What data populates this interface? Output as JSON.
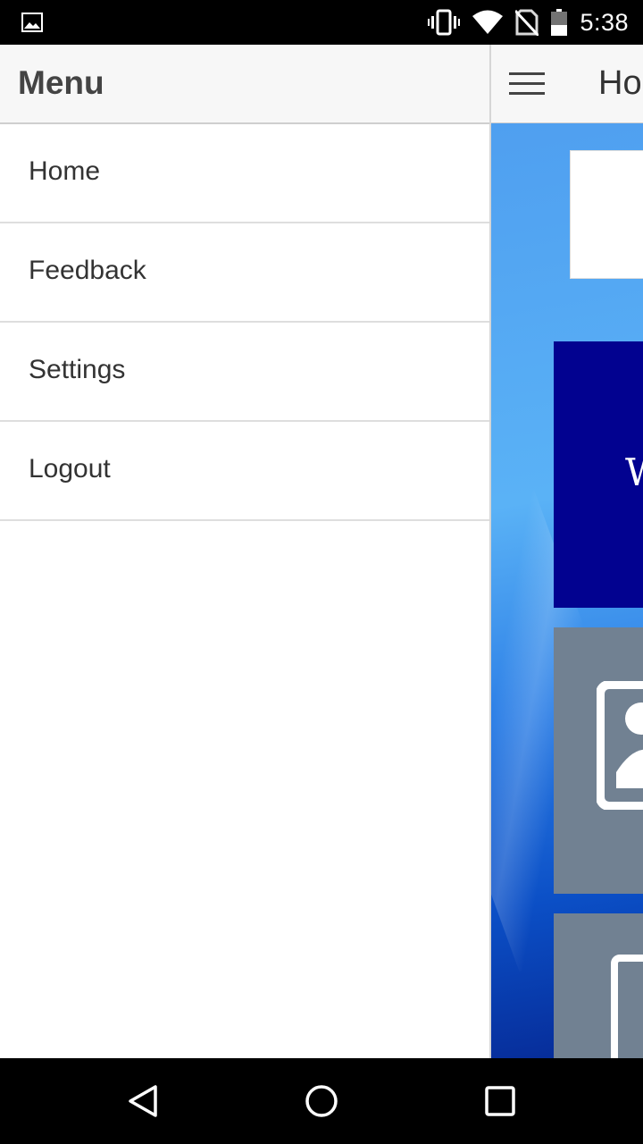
{
  "status_bar": {
    "time": "5:38",
    "icons": [
      "image-icon",
      "vibrate-icon",
      "wifi-icon",
      "no-sim-icon",
      "battery-icon"
    ]
  },
  "main": {
    "header_title": "Ho",
    "card_text": "W"
  },
  "drawer": {
    "title": "Menu",
    "items": [
      {
        "label": "Home"
      },
      {
        "label": "Feedback"
      },
      {
        "label": "Settings"
      },
      {
        "label": "Logout"
      }
    ]
  },
  "nav_bar": {
    "icons": [
      "back-icon",
      "home-circle-icon",
      "recents-icon"
    ]
  },
  "colors": {
    "navy_card": "#020290",
    "gray_card": "#718192",
    "drawer_header": "#f7f7f7"
  }
}
